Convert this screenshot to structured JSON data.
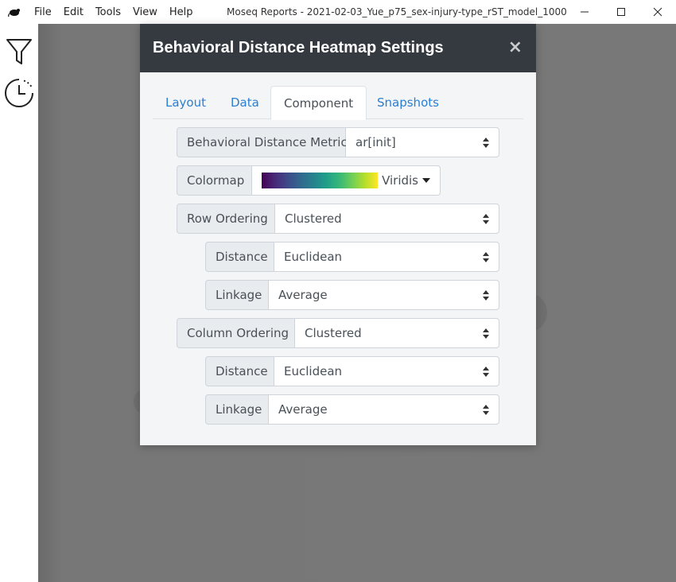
{
  "window": {
    "title": "Moseq Reports - 2021-02-03_Yue_p75_sex-injury-type_rST_model_1000",
    "menu": [
      "File",
      "Edit",
      "Tools",
      "View",
      "Help"
    ]
  },
  "sidebar": {
    "icons": [
      "filter-icon",
      "history-clock-icon"
    ]
  },
  "modal": {
    "title": "Behavioral Distance Heatmap Settings",
    "close_label": "×",
    "tabs": [
      "Layout",
      "Data",
      "Component",
      "Snapshots"
    ],
    "active_tab": "Component",
    "fields": {
      "metric": {
        "label": "Behavioral Distance Metric",
        "value": "ar[init]"
      },
      "colormap": {
        "label": "Colormap",
        "value": "Viridis"
      },
      "row_ordering": {
        "label": "Row Ordering",
        "value": "Clustered"
      },
      "row_distance": {
        "label": "Distance",
        "value": "Euclidean"
      },
      "row_linkage": {
        "label": "Linkage",
        "value": "Average"
      },
      "col_ordering": {
        "label": "Column Ordering",
        "value": "Clustered"
      },
      "col_distance": {
        "label": "Distance",
        "value": "Euclidean"
      },
      "col_linkage": {
        "label": "Linkage",
        "value": "Average"
      }
    }
  },
  "colors": {
    "header_bg": "#343a40",
    "link": "#2a7fd4",
    "backdrop": "#787878"
  }
}
